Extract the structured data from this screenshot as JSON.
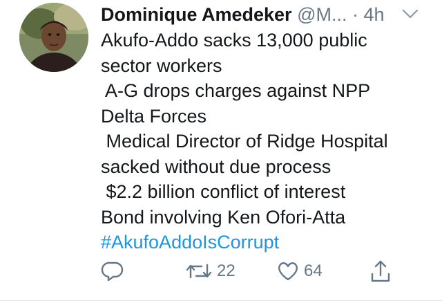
{
  "tweet": {
    "author_name": "Dominique Amedeker",
    "handle": "@M...",
    "separator": "·",
    "time": "4h",
    "text_lines": [
      "Akufo-Addo sacks 13,000 public",
      "sector workers",
      " A-G drops charges against NPP",
      "Delta Forces",
      " Medical Director of Ridge Hospital",
      "sacked without due process",
      " $2.2 billion conflict of interest",
      "Bond involving Ken Ofori-Atta"
    ],
    "hashtag": "#AkufoAddoIsCorrupt"
  },
  "actions": {
    "reply": {
      "icon": "reply-icon"
    },
    "retweet": {
      "icon": "retweet-icon",
      "count": "22"
    },
    "like": {
      "icon": "heart-icon",
      "count": "64"
    },
    "share": {
      "icon": "share-icon"
    }
  },
  "colors": {
    "text": "#14171a",
    "secondary": "#657786",
    "link": "#1b95e0"
  }
}
